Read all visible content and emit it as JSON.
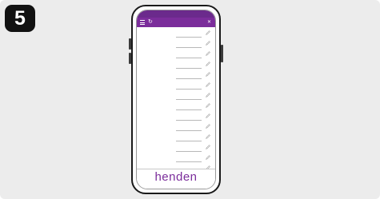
{
  "step": {
    "number": "5"
  },
  "colors": {
    "brand_purple": "#7b2d9b",
    "status_purple": "#6b2a8c"
  },
  "status_bar": {
    "time": "",
    "icons": ""
  },
  "app_bar": {
    "title": "",
    "menu_icon": "menu-icon",
    "refresh_icon": "refresh-icon",
    "close_icon": "close-icon"
  },
  "settings": {
    "rows": [
      {
        "label": "",
        "value": ""
      },
      {
        "label": "",
        "value": ""
      },
      {
        "label": "",
        "value": ""
      },
      {
        "label": "",
        "value": ""
      },
      {
        "label": "",
        "value": ""
      },
      {
        "label": "",
        "value": ""
      },
      {
        "label": "",
        "value": ""
      },
      {
        "label": "",
        "value": ""
      },
      {
        "label": "",
        "value": ""
      },
      {
        "label": "",
        "value": ""
      },
      {
        "label": "",
        "value": ""
      },
      {
        "label": "",
        "value": ""
      },
      {
        "label": "",
        "value": ""
      },
      {
        "label": "",
        "value": ""
      },
      {
        "label": "",
        "value": ""
      }
    ]
  },
  "footer": {
    "brand": "henden"
  }
}
